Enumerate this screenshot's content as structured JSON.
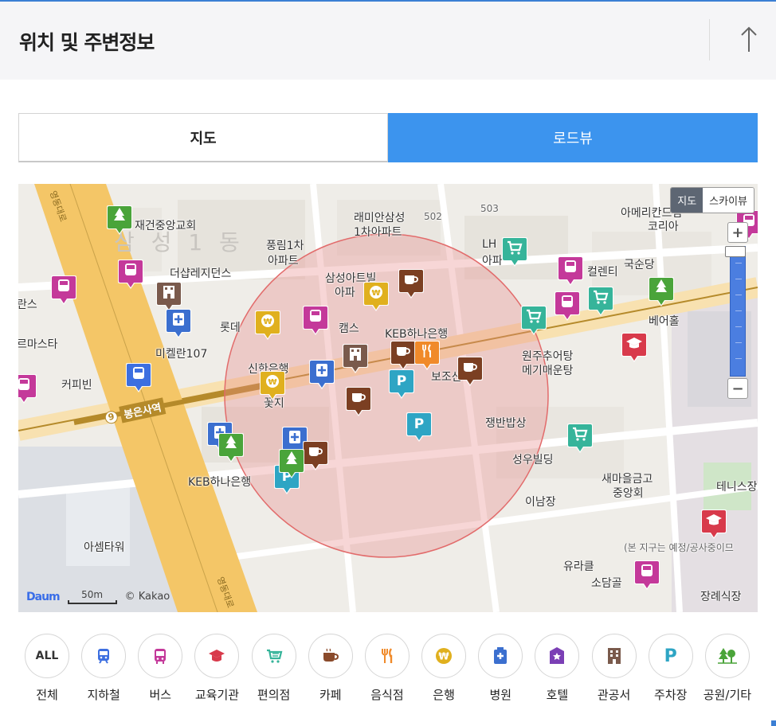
{
  "header": {
    "title": "위치 및 주변정보"
  },
  "tabs": [
    {
      "label": "지도",
      "selected": false
    },
    {
      "label": "로드뷰",
      "selected": true
    }
  ],
  "map": {
    "type_toggle": {
      "map": "지도",
      "skyview": "스카이뷰"
    },
    "zoom_in": "+",
    "zoom_out": "−",
    "scale": "50m",
    "logo": "Daum",
    "copyright": "© Kakao",
    "big_area_label": "삼 성 1 동",
    "labels": [
      "재건중앙교회",
      "래미안삼성",
      "1차아파트",
      "502",
      "503",
      "아메리칸드림",
      "코리아",
      "풍림1차",
      "아파트",
      "더샵레지던스",
      "삼성아트빌",
      "아파",
      "LH",
      "아파",
      "컬렌티",
      "국순당",
      "롯데",
      "KEB하나은행",
      "미켈란107",
      "베어홀",
      "원주추어탕",
      "메기매운탕",
      "커피빈",
      "봉은사역",
      "신한은행",
      "꽃지",
      "쟁반밥상",
      "성우빌딩",
      "새마을금고",
      "중앙회",
      "테니스장",
      "KEB하나은행",
      "이남장",
      "아셈타워",
      "유라클",
      "소담골",
      "장례식장",
      "(본 지구는 예정/공사중이므",
      "란스",
      "르마스타",
      "캠스",
      "보조산",
      "영동대로",
      "영동대로"
    ],
    "station": {
      "number": "9",
      "name": "봉은사역"
    }
  },
  "categories": [
    {
      "label": "전체",
      "icon": "all-icon",
      "color": "#333333"
    },
    {
      "label": "지하철",
      "icon": "subway-icon",
      "color": "#3d6fe0"
    },
    {
      "label": "버스",
      "icon": "bus-icon",
      "color": "#c4399a"
    },
    {
      "label": "교육기관",
      "icon": "education-icon",
      "color": "#d83a4b"
    },
    {
      "label": "편의점",
      "icon": "convenience-store-icon",
      "color": "#36b49a"
    },
    {
      "label": "카페",
      "icon": "cafe-icon",
      "color": "#8a4a2b"
    },
    {
      "label": "음식점",
      "icon": "restaurant-icon",
      "color": "#f08a2a"
    },
    {
      "label": "은행",
      "icon": "bank-icon",
      "color": "#e0b01e"
    },
    {
      "label": "병원",
      "icon": "hospital-icon",
      "color": "#3b6fcf"
    },
    {
      "label": "호텔",
      "icon": "hotel-icon",
      "color": "#7b3fb5"
    },
    {
      "label": "관공서",
      "icon": "government-office-icon",
      "color": "#7a5a4c"
    },
    {
      "label": "주차장",
      "icon": "parking-icon",
      "color": "#2ea5c4"
    },
    {
      "label": "공원/기타",
      "icon": "park-icon",
      "color": "#4aa43a"
    }
  ],
  "colors": {
    "accent": "#3c94ee",
    "radius_fill": "#e88a8a",
    "road_main": "#f5c96a"
  }
}
